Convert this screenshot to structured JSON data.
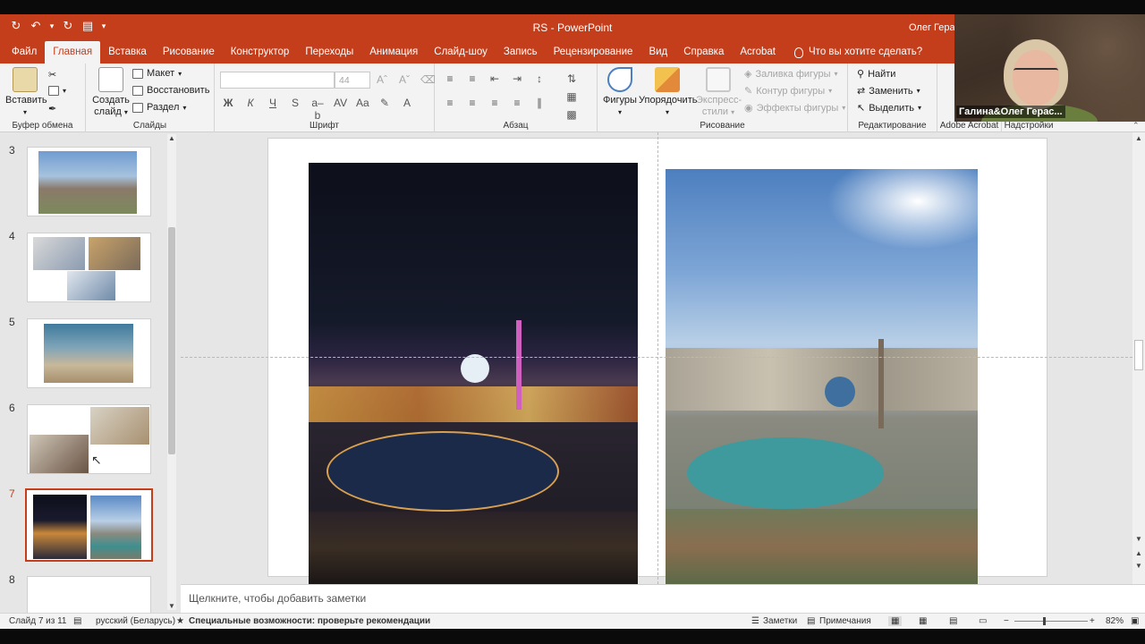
{
  "window": {
    "doc_title": "RS",
    "app_name": "PowerPoint",
    "title_separator": " - ",
    "user": "Олег Гераси"
  },
  "tabs": [
    {
      "label": "Файл",
      "active": false
    },
    {
      "label": "Главная",
      "active": true
    },
    {
      "label": "Вставка",
      "active": false
    },
    {
      "label": "Рисование",
      "active": false
    },
    {
      "label": "Конструктор",
      "active": false
    },
    {
      "label": "Переходы",
      "active": false
    },
    {
      "label": "Анимация",
      "active": false
    },
    {
      "label": "Слайд-шоу",
      "active": false
    },
    {
      "label": "Запись",
      "active": false
    },
    {
      "label": "Рецензирование",
      "active": false
    },
    {
      "label": "Вид",
      "active": false
    },
    {
      "label": "Справка",
      "active": false
    },
    {
      "label": "Acrobat",
      "active": false
    }
  ],
  "tell_me": "Что вы хотите сделать?",
  "ribbon": {
    "clipboard": {
      "label": "Буфер обмена",
      "paste": "Вставить"
    },
    "slides": {
      "label": "Слайды",
      "new_slide_line1": "Создать",
      "new_slide_line2": "слайд",
      "layout": "Макет",
      "reset": "Восстановить",
      "section": "Раздел"
    },
    "font": {
      "label": "Шрифт",
      "size": "44"
    },
    "paragraph": {
      "label": "Абзац"
    },
    "drawing": {
      "label": "Рисование",
      "shapes": "Фигуры",
      "arrange": "Упорядочить",
      "quick_styles_1": "Экспресс-",
      "quick_styles_2": "стили",
      "fill": "Заливка фигуры",
      "outline": "Контур фигуры",
      "effects": "Эффекты фигуры"
    },
    "editing": {
      "label": "Редактирование",
      "find": "Найти",
      "replace": "Заменить",
      "select": "Выделить"
    },
    "adobe": {
      "label": "Adobe Acrobat"
    },
    "addins": {
      "label": "Надстройки"
    }
  },
  "webcam": {
    "name": "Галина&Олег Герас..."
  },
  "thumbnails": [
    {
      "num": "3",
      "active": false
    },
    {
      "num": "4",
      "active": false
    },
    {
      "num": "5",
      "active": false
    },
    {
      "num": "6",
      "active": false
    },
    {
      "num": "7",
      "active": true
    },
    {
      "num": "8",
      "active": false
    }
  ],
  "notes_placeholder": "Щелкните, чтобы добавить заметки",
  "status": {
    "slide_info": "Слайд 7 из 11",
    "language": "русский (Беларусь)",
    "accessibility": "Специальные возможности: проверьте рекомендации",
    "notes": "Заметки",
    "comments": "Примечания",
    "zoom": "82%",
    "zoom_level": 0.82
  },
  "colors": {
    "accent": "#c43e1c",
    "ribbon": "#f3f3f3",
    "canvas": "#e6e6e6"
  }
}
